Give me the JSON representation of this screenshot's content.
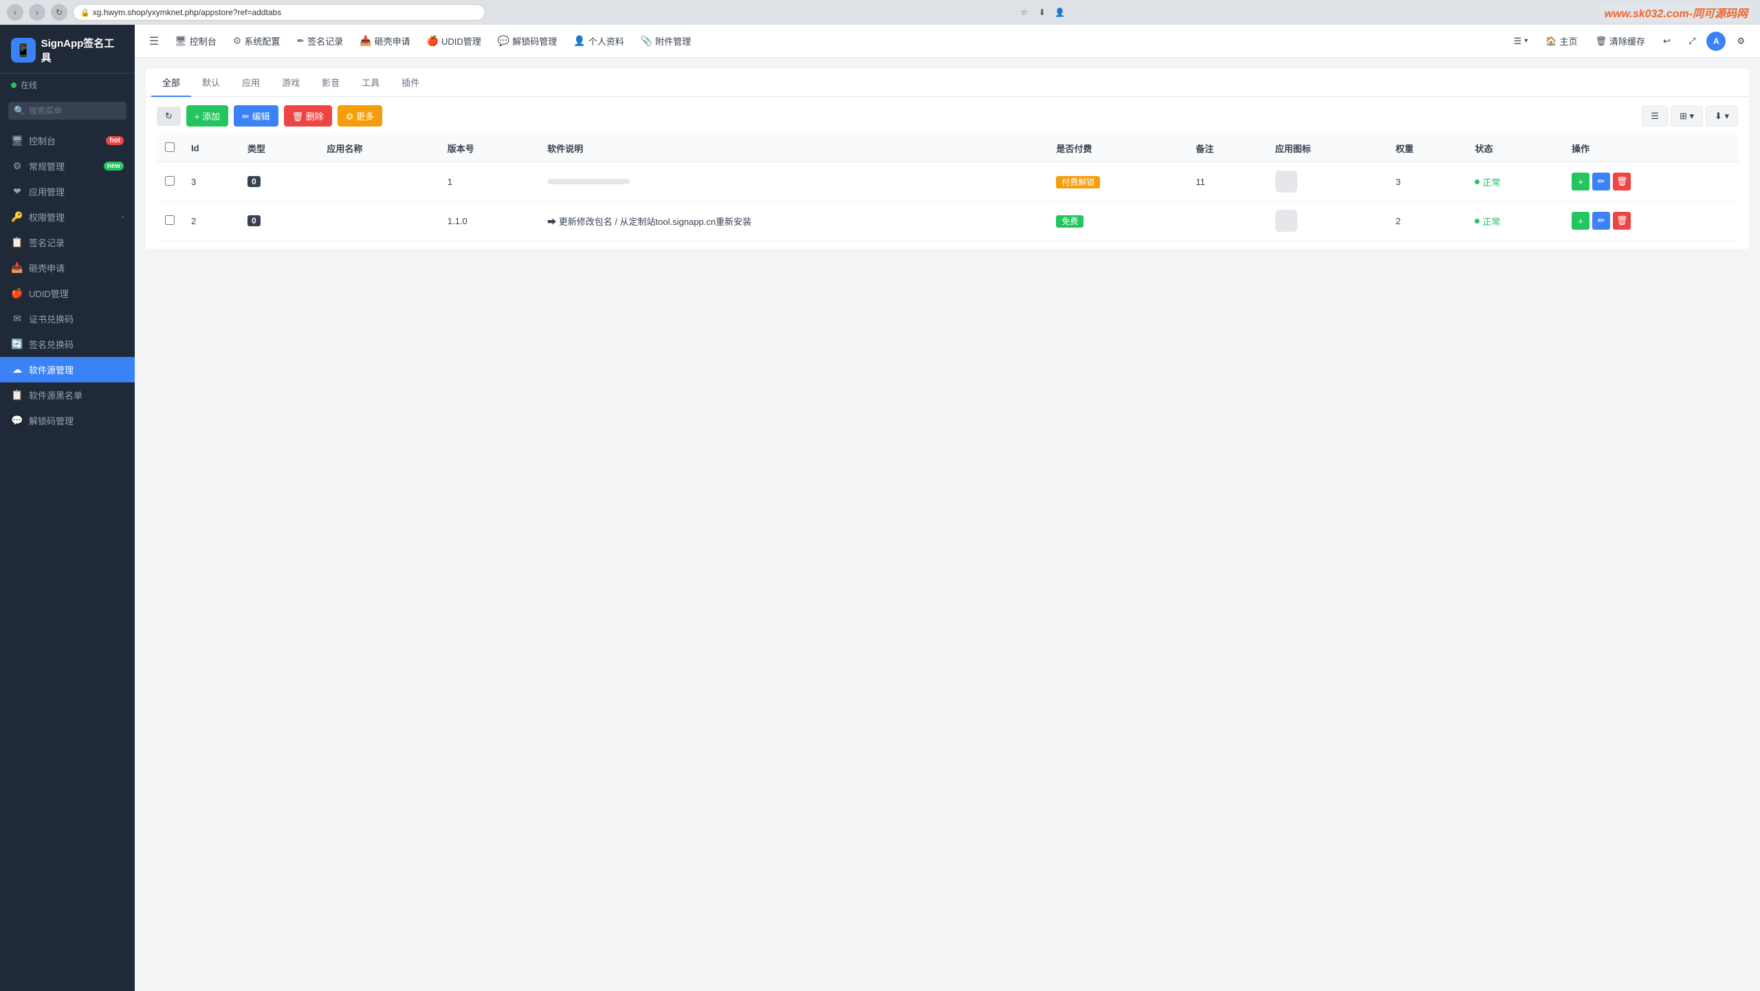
{
  "browser": {
    "url": "xg.hwym.shop/yxymknet.php/appstore?ref=addtabs",
    "watermark": "www.sk032.com-同可源码网"
  },
  "sidebar": {
    "logo_text": "SignApp签名工具",
    "status_text": "在线",
    "search_placeholder": "搜索菜单",
    "items": [
      {
        "id": "dashboard",
        "icon": "🖥",
        "label": "控制台",
        "badge": "hot",
        "badge_type": "hot"
      },
      {
        "id": "common",
        "icon": "⚙",
        "label": "常规管理",
        "badge": "new",
        "badge_type": "new"
      },
      {
        "id": "app",
        "icon": "❤",
        "label": "应用管理",
        "badge": "",
        "badge_type": ""
      },
      {
        "id": "permission",
        "icon": "🔑",
        "label": "权限管理",
        "badge": "",
        "badge_type": "",
        "has_chevron": true
      },
      {
        "id": "sign",
        "icon": "📋",
        "label": "签名记录",
        "badge": "",
        "badge_type": ""
      },
      {
        "id": "shell",
        "icon": "📥",
        "label": "砸壳申请",
        "badge": "",
        "badge_type": ""
      },
      {
        "id": "udid",
        "icon": "🍎",
        "label": "UDID管理",
        "badge": "",
        "badge_type": ""
      },
      {
        "id": "cert",
        "icon": "✉",
        "label": "证书兑换码",
        "badge": "",
        "badge_type": ""
      },
      {
        "id": "sign-code",
        "icon": "🔄",
        "label": "签名兑换码",
        "badge": "",
        "badge_type": ""
      },
      {
        "id": "software",
        "icon": "☁",
        "label": "软件源管理",
        "badge": "",
        "badge_type": "",
        "active": true
      },
      {
        "id": "blacklist",
        "icon": "📋",
        "label": "软件源黑名单",
        "badge": "",
        "badge_type": ""
      },
      {
        "id": "unlock",
        "icon": "💬",
        "label": "解锁码管理",
        "badge": "",
        "badge_type": ""
      }
    ]
  },
  "topbar": {
    "menu_icon": "☰",
    "nav_items": [
      {
        "id": "dashboard",
        "icon": "🖥",
        "label": "控制台"
      },
      {
        "id": "sysconfig",
        "icon": "⚙",
        "label": "系统配置"
      },
      {
        "id": "signrecord",
        "icon": "✒",
        "label": "签名记录"
      },
      {
        "id": "shell",
        "icon": "📥",
        "label": "砸壳申请"
      },
      {
        "id": "udid",
        "icon": "🍎",
        "label": "UDID管理"
      },
      {
        "id": "unlock",
        "icon": "💬",
        "label": "解锁码管理"
      },
      {
        "id": "profile",
        "icon": "👤",
        "label": "个人资料"
      },
      {
        "id": "attachment",
        "icon": "📎",
        "label": "附件管理"
      }
    ],
    "right_items": [
      {
        "id": "menu-more",
        "icon": "☰▾",
        "label": ""
      },
      {
        "id": "home",
        "icon": "🏠",
        "label": "主页"
      },
      {
        "id": "clear-cache",
        "icon": "🗑",
        "label": "清除缓存"
      },
      {
        "id": "refresh",
        "icon": "↩",
        "label": ""
      },
      {
        "id": "fullscreen",
        "icon": "⤢",
        "label": ""
      },
      {
        "id": "avatar",
        "label": ""
      }
    ]
  },
  "tabs": [
    {
      "id": "all",
      "label": "全部",
      "active": true
    },
    {
      "id": "default",
      "label": "默认"
    },
    {
      "id": "app",
      "label": "应用"
    },
    {
      "id": "game",
      "label": "游戏"
    },
    {
      "id": "movie",
      "label": "影音"
    },
    {
      "id": "tool",
      "label": "工具"
    },
    {
      "id": "plugin",
      "label": "插件"
    }
  ],
  "toolbar": {
    "refresh_label": "↻",
    "add_label": "+ 添加",
    "edit_label": "✏ 编辑",
    "delete_label": "🗑 删除",
    "more_label": "⚙ 更多"
  },
  "table": {
    "columns": [
      "Id",
      "类型",
      "应用名称",
      "版本号",
      "软件说明",
      "是否付费",
      "备注",
      "应用图标",
      "权重",
      "状态",
      "操作"
    ],
    "rows": [
      {
        "id": "3",
        "type_tag": "0",
        "app_name": "",
        "version": "1",
        "description": "",
        "is_paid": true,
        "paid_label": "付费解锁",
        "note": "11",
        "weight": "3",
        "status": "正常",
        "status_type": "normal"
      },
      {
        "id": "2",
        "type_tag": "0",
        "app_name": "",
        "version": "1.1.0",
        "description": "➡ 更新修改包名 / 从定制站tool.signapp.cn重新安装",
        "is_paid": false,
        "paid_label": "免费",
        "note": "",
        "weight": "2",
        "status": "正常",
        "status_type": "normal"
      }
    ]
  }
}
